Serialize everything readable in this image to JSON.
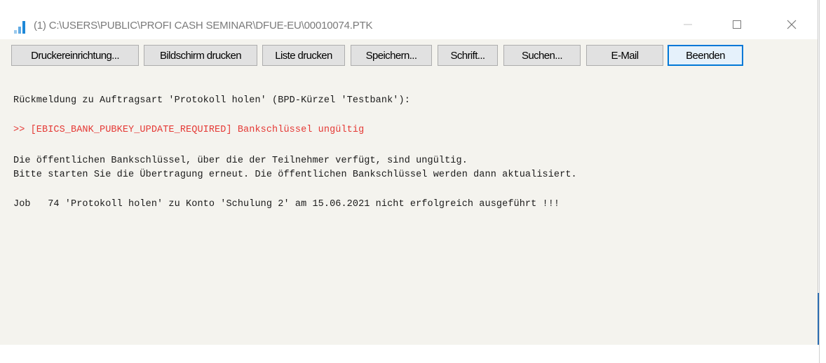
{
  "window": {
    "title": "(1) C:\\USERS\\PUBLIC\\PROFI CASH SEMINAR\\DFUE-EU\\00010074.PTK",
    "minimize_glyph": "—",
    "maximize_glyph": "☐",
    "close_glyph": "✕"
  },
  "toolbar": {
    "druckereinrichtung_label": "Druckereinrichtung...",
    "bildschirm_drucken_label": "Bildschirm drucken",
    "liste_drucken_label": "Liste drucken",
    "speichern_label": "Speichern...",
    "schrift_label": "Schrift...",
    "suchen_label": "Suchen...",
    "email_label": "E-Mail",
    "beenden_label": "Beenden"
  },
  "log": {
    "line1": "Rückmeldung zu Auftragsart 'Protokoll holen' (BPD-Kürzel 'Testbank'):",
    "line2": ">> [EBICS_BANK_PUBKEY_UPDATE_REQUIRED] Bankschlüssel ungültig",
    "line3": "Die öffentlichen Bankschlüssel, über die der Teilnehmer verfügt, sind ungültig.",
    "line4": "Bitte starten Sie die Übertragung erneut. Die öffentlichen Bankschlüssel werden dann aktualisiert.",
    "line5": "Job   74 'Protokoll holen' zu Konto 'Schulung 2' am 15.06.2021 nicht erfolgreich ausgeführt !!!"
  },
  "colors": {
    "error_text": "#e53935",
    "accent": "#0078d7",
    "icon": "#1e88d8"
  },
  "icons": {
    "app": "signal-bars-icon",
    "minimize": "minimize-icon",
    "maximize": "maximize-icon",
    "close": "close-icon"
  }
}
